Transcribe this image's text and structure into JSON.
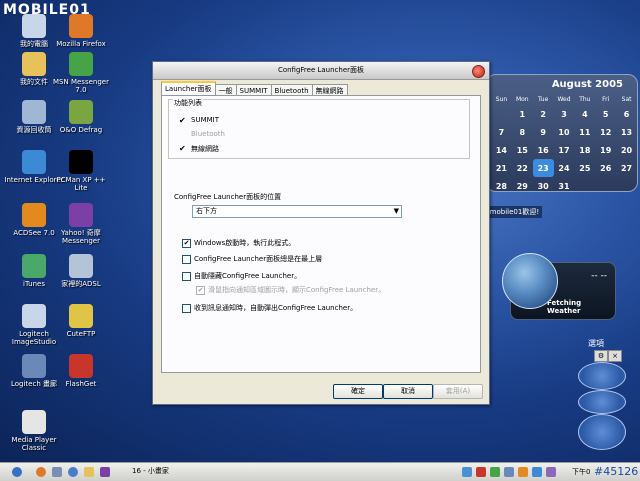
{
  "desktop": {
    "logo": "MOBILE01",
    "icons": [
      {
        "label": "我的電腦",
        "color": "#c9d6ea"
      },
      {
        "label": "Mozilla Firefox",
        "color": "#e0782a"
      },
      {
        "label": "我的文件",
        "color": "#e7c25a"
      },
      {
        "label": "MSN Messenger 7.0",
        "color": "#47a347"
      },
      {
        "label": "資源回收筒",
        "color": "#9fb7d4"
      },
      {
        "label": "O&O Defrag",
        "color": "#7aa641"
      },
      {
        "label": "Internet Explorer",
        "color": "#3c8ad6"
      },
      {
        "label": "PCMan XP ++ Lite",
        "color": "#000000"
      },
      {
        "label": "ACDSee 7.0",
        "color": "#e38a1f"
      },
      {
        "label": "Yahoo! 奇摩 Messenger",
        "color": "#7b3fa6"
      },
      {
        "label": "iTunes",
        "color": "#4aa86b"
      },
      {
        "label": "家裡的ADSL",
        "color": "#b5c3d6"
      },
      {
        "label": "Logitech ImageStudio",
        "color": "#c9d6ea"
      },
      {
        "label": "CuteFTP",
        "color": "#e0c447"
      },
      {
        "label": "Logitech 畫廊",
        "color": "#6a88b8"
      },
      {
        "label": "FlashGet",
        "color": "#c8352a"
      },
      {
        "label": "Media Player Classic",
        "color": "#e5e5e5"
      }
    ]
  },
  "calendar": {
    "month": "August 2005",
    "weekdays": [
      "Sun",
      "Mon",
      "Tue",
      "Wed",
      "Thu",
      "Fri",
      "Sat"
    ],
    "weeks": [
      [
        "",
        "1",
        "2",
        "3",
        "4",
        "5",
        "6"
      ],
      [
        "7",
        "8",
        "9",
        "10",
        "11",
        "12",
        "13"
      ],
      [
        "14",
        "15",
        "16",
        "17",
        "18",
        "19",
        "20"
      ],
      [
        "21",
        "22",
        "23",
        "24",
        "25",
        "26",
        "27"
      ],
      [
        "28",
        "29",
        "30",
        "31",
        "",
        "",
        ""
      ]
    ],
    "today": "23"
  },
  "welcome": "g.mobile01歡迎!",
  "weather": {
    "label": "Fetching Weather",
    "display": "-- --"
  },
  "options_widget": {
    "label": "選項"
  },
  "dialog": {
    "title": "ConfigFree Launcher面板",
    "tabs": [
      "Launcher面板",
      "一般",
      "SUMMIT",
      "Bluetooth",
      "無線網路"
    ],
    "feature_list_label": "功能列表",
    "features": [
      {
        "label": "SUMMIT",
        "checked": true,
        "enabled": true
      },
      {
        "label": "Bluetooth",
        "checked": false,
        "enabled": false
      },
      {
        "label": "無線網路",
        "checked": true,
        "enabled": true
      }
    ],
    "position_label": "ConfigFree Launcher面板的位置",
    "position_value": "右下方",
    "options": [
      {
        "label": "Windows啟動時，執行此程式。",
        "checked": true,
        "enabled": true
      },
      {
        "label": "ConfigFree Launcher面板總是在最上層",
        "checked": false,
        "enabled": true
      },
      {
        "label": "自動隱藏ConfigFree Launcher。",
        "checked": false,
        "enabled": true
      },
      {
        "label": "滑鼠指向通知區域圖示時，顯示ConfigFree Launcher。",
        "checked": true,
        "enabled": false
      },
      {
        "label": "收到訊息通知時，自動彈出ConfigFree Launcher。",
        "checked": false,
        "enabled": true
      }
    ],
    "buttons": {
      "ok": "確定",
      "cancel": "取消",
      "apply": "套用(A)"
    }
  },
  "taskbar": {
    "task": "16 - 小畫家",
    "clock": "下午0",
    "counter": "#45126"
  }
}
